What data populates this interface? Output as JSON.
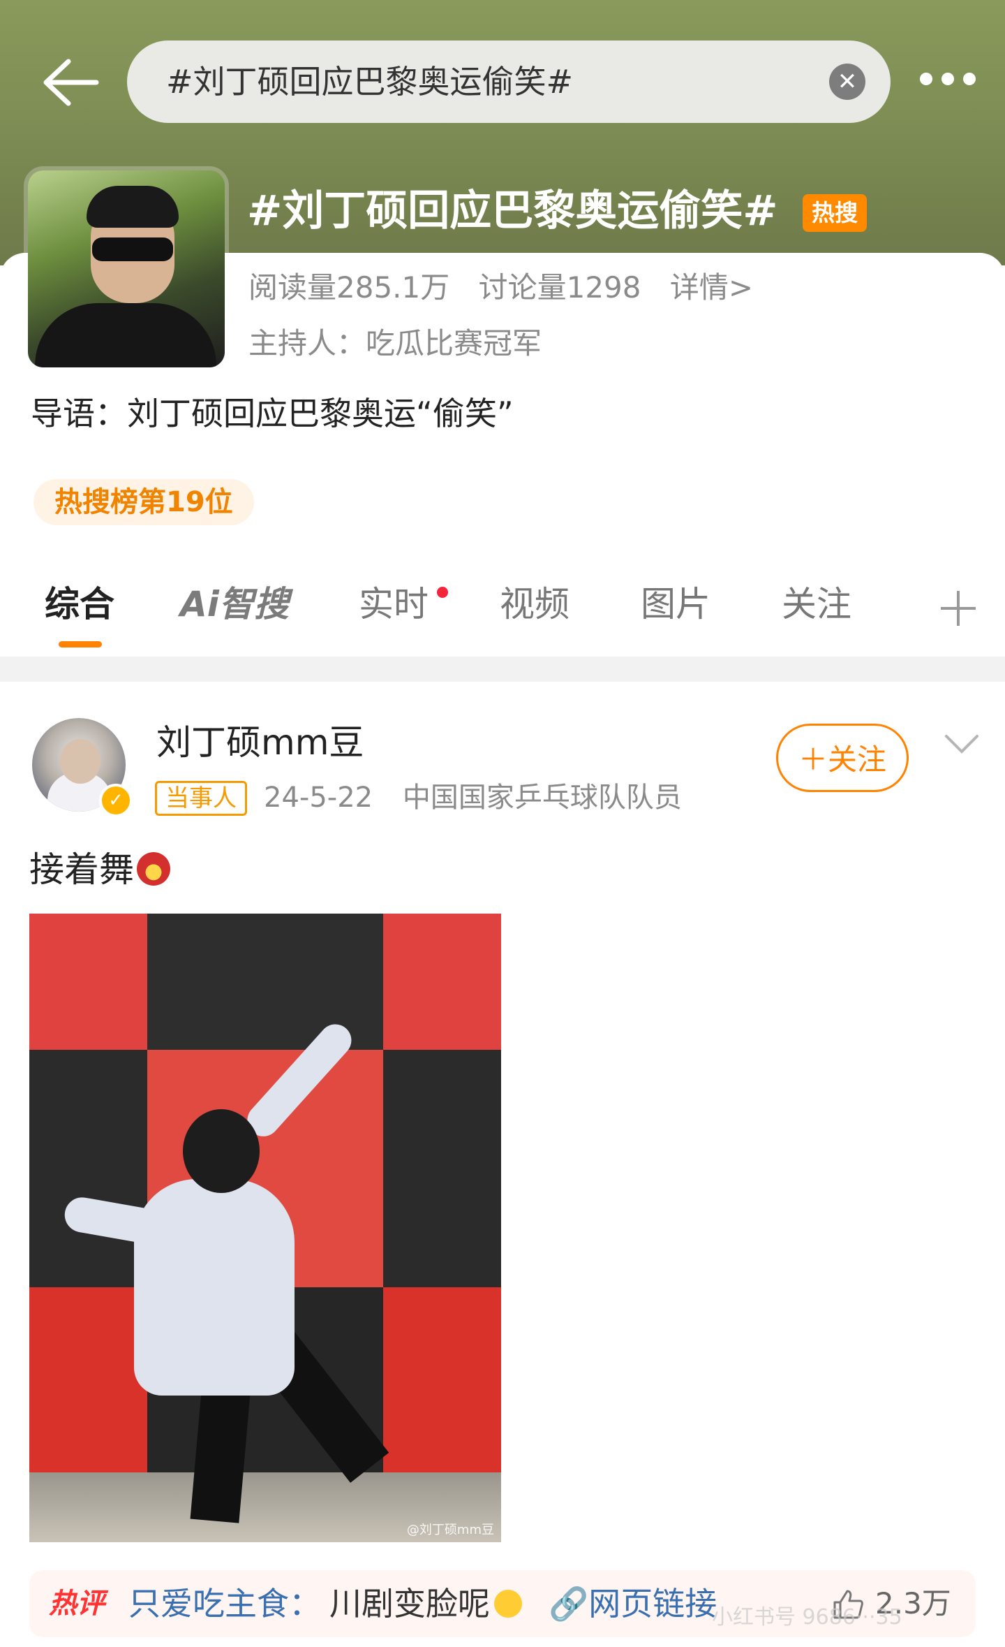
{
  "header": {
    "search_query": "#刘丁硕回应巴黎奥运偷笑#",
    "clear_icon": "close-circle-icon",
    "back_icon": "back-arrow-icon",
    "more_icon": "more-dots-icon"
  },
  "topic": {
    "title": "#刘丁硕回应巴黎奥运偷笑#",
    "badge": "热搜",
    "reads": "阅读量285.1万",
    "discussions": "讨论量1298",
    "details_link": "详情>",
    "host": "主持人：吃瓜比赛冠军",
    "intro": "导语：刘丁硕回应巴黎奥运“偷笑”",
    "rank": "热搜榜第19位"
  },
  "tabs": {
    "items": [
      {
        "label": "综合"
      },
      {
        "label": "Ai智搜"
      },
      {
        "label": "实时"
      },
      {
        "label": "视频"
      },
      {
        "label": "图片"
      },
      {
        "label": "关注"
      }
    ],
    "active_index": 0,
    "add_icon": "plus-icon"
  },
  "post": {
    "username": "刘丁硕mm豆",
    "role_tag": "当事人",
    "date": "24-5-22",
    "bio": "中国国家乒乓球队队员",
    "follow_label": "＋关注",
    "text": "接着舞",
    "photo_watermark": "@刘丁硕mm豆"
  },
  "hot_comment": {
    "label": "热评",
    "user": "只爱吃主食：",
    "text": "川剧变脸呢",
    "link_label": "🔗网页链接",
    "likes": "2.3万"
  },
  "overlay_watermark": "小红书号 9686···35",
  "colors": {
    "accent": "#ff8200",
    "hot_badge": "#ff8a00",
    "link": "#3a6fb0",
    "header_bg": "#7f8f55"
  }
}
